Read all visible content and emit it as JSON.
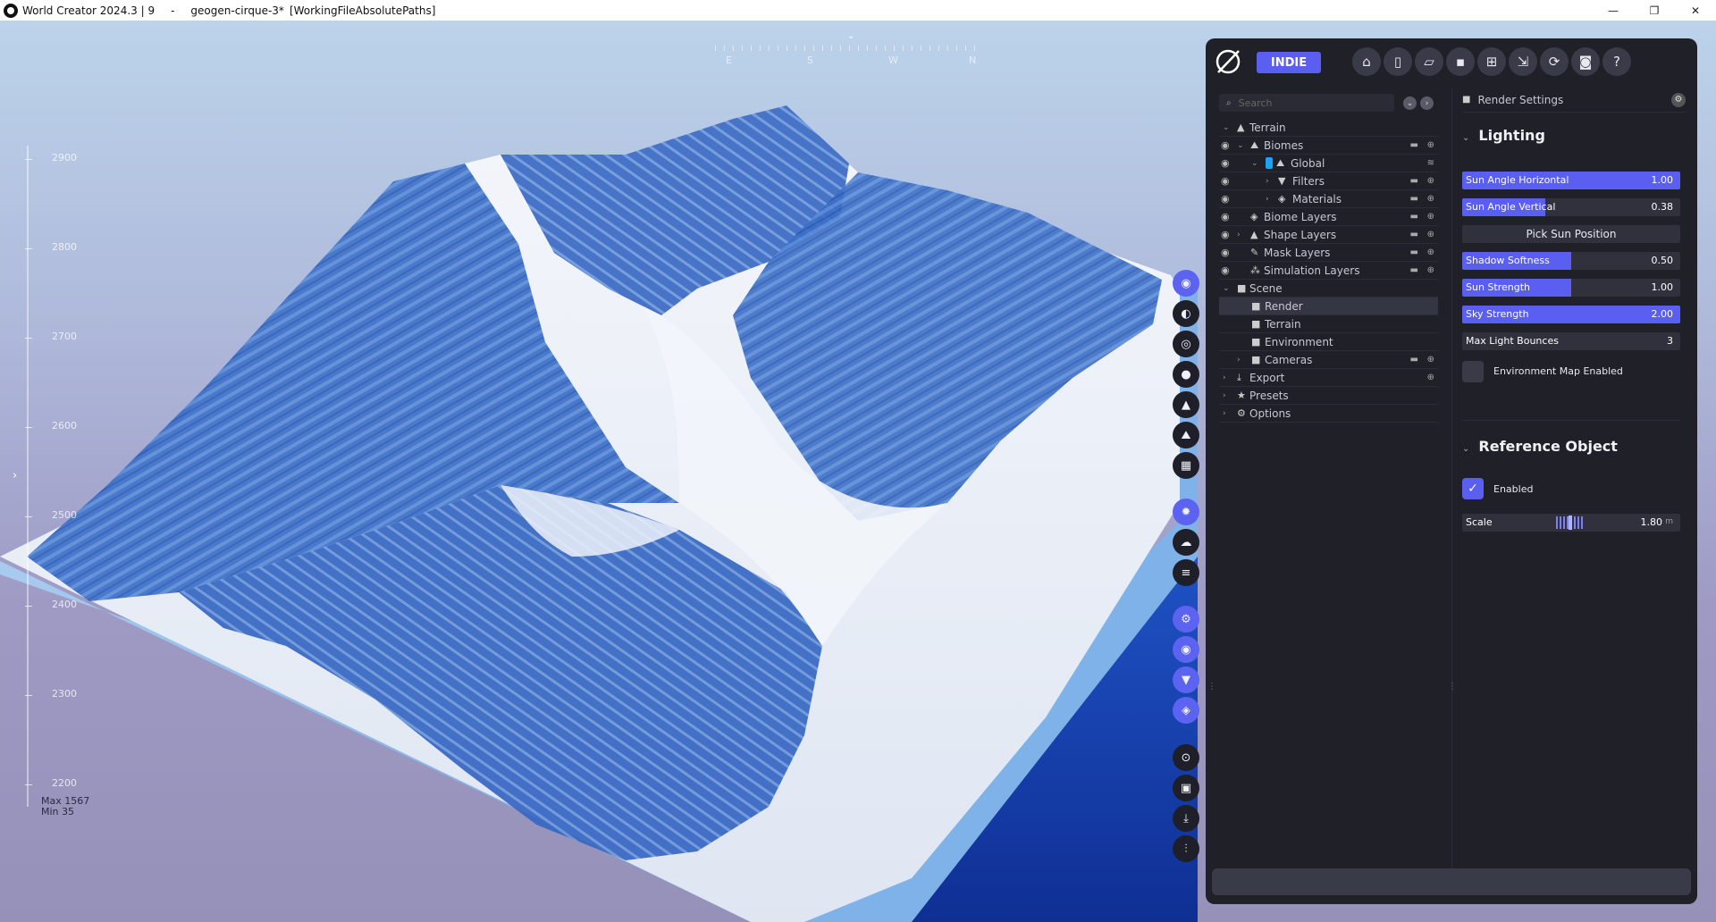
{
  "window": {
    "app": "World Creator 2024.3 | 9",
    "separator": "-",
    "file": "geogen-cirque-3*",
    "mode": "[WorkingFileAbsolutePaths]",
    "controls": [
      "—",
      "❐",
      "✕"
    ]
  },
  "viewport": {
    "compass": [
      "E",
      "S",
      "W",
      "N"
    ],
    "elevation_ticks": [
      "2900",
      "2800",
      "2700",
      "2600",
      "2500",
      "2400",
      "2300",
      "2200"
    ],
    "max_label": "Max 1567",
    "min_label": "Min 35"
  },
  "toolbar": {
    "edition": "INDIE",
    "buttons": [
      "home-icon",
      "new-file-icon",
      "open-folder-icon",
      "save-icon",
      "save-as-icon",
      "export-icon",
      "sync-icon",
      "camera-icon",
      "help-icon"
    ]
  },
  "tree": {
    "search_placeholder": "Search",
    "items": [
      {
        "label": "Terrain"
      },
      {
        "label": "Biomes"
      },
      {
        "label": "Global"
      },
      {
        "label": "Filters"
      },
      {
        "label": "Materials"
      },
      {
        "label": "Biome Layers"
      },
      {
        "label": "Shape Layers"
      },
      {
        "label": "Mask Layers"
      },
      {
        "label": "Simulation Layers"
      },
      {
        "label": "Scene"
      },
      {
        "label": "Render"
      },
      {
        "label": "Terrain"
      },
      {
        "label": "Environment"
      },
      {
        "label": "Cameras"
      },
      {
        "label": "Export"
      },
      {
        "label": "Presets"
      },
      {
        "label": "Options"
      }
    ]
  },
  "props": {
    "header": "Render Settings",
    "lighting": {
      "title": "Lighting",
      "sliders": [
        {
          "label": "Sun Angle Horizontal",
          "value": "1.00",
          "fill": 1.0
        },
        {
          "label": "Sun Angle Vertical",
          "value": "0.38",
          "fill": 0.38
        },
        {
          "label": "Shadow Softness",
          "value": "0.50",
          "fill": 0.5
        },
        {
          "label": "Sun Strength",
          "value": "1.00",
          "fill": 0.5
        },
        {
          "label": "Sky Strength",
          "value": "2.00",
          "fill": 1.0
        },
        {
          "label": "Max Light Bounces",
          "value": "3",
          "fill": 0.0
        }
      ],
      "pick_button": "Pick Sun Position",
      "env_map_label": "Environment Map Enabled"
    },
    "reference": {
      "title": "Reference Object",
      "enabled_label": "Enabled",
      "scale_label": "Scale",
      "scale_value": "1.80",
      "scale_unit": "m"
    }
  },
  "colors": {
    "accent": "#5a5ff2",
    "panel_bg": "#1f2028",
    "terrain_blue": "#3a6cc4",
    "snow": "#eef1f8"
  }
}
